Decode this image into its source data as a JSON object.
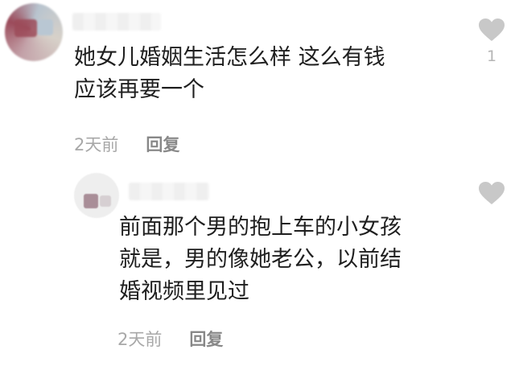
{
  "comments": [
    {
      "text_lines": [
        "她女儿婚姻生活怎么样 这么有钱",
        "应该再要一个"
      ],
      "time": "2天前",
      "reply_label": "回复",
      "like_count": "1",
      "like_icon": "heart-icon"
    },
    {
      "text_lines": [
        "前面那个男的抱上车的小女孩",
        "就是，男的像她老公，以前结",
        "婚视频里见过"
      ],
      "time": "2天前",
      "reply_label": "回复",
      "like_count": "",
      "like_icon": "heart-icon"
    }
  ],
  "colors": {
    "text": "#1f1f1f",
    "meta_time": "#a8a8a8",
    "reply": "#888888",
    "heart": "#c8c8c8"
  }
}
